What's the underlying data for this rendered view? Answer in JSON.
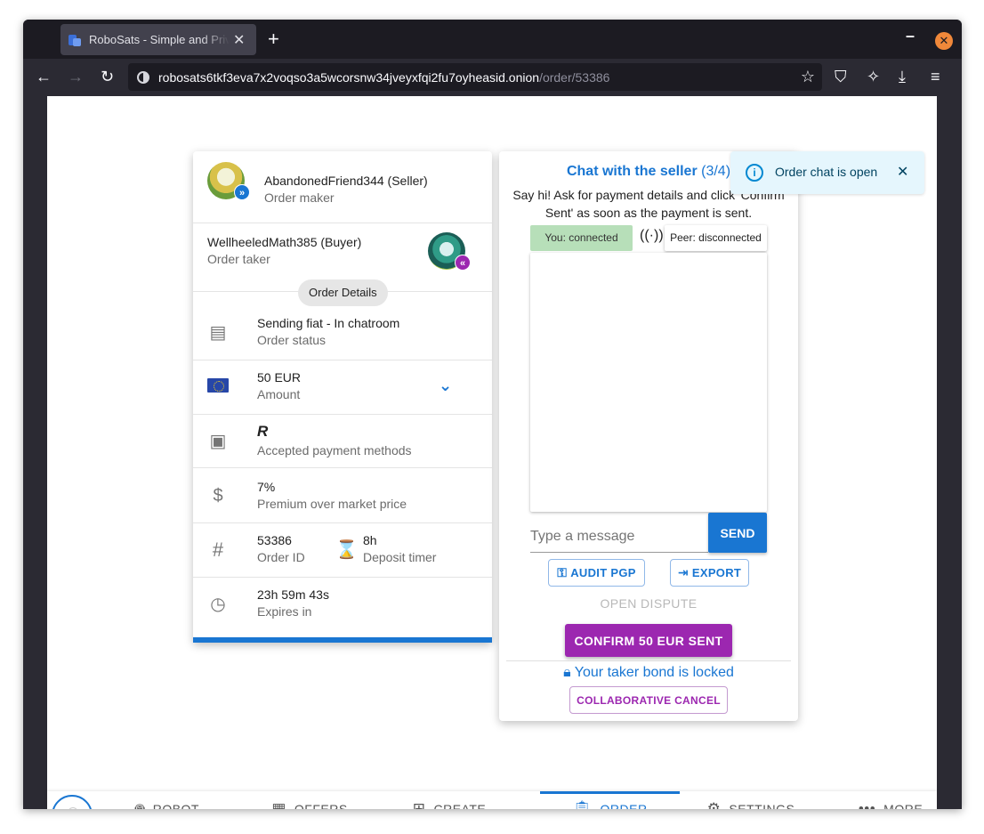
{
  "browser": {
    "tab_title": "RoboSats - Simple and Private Bitcoin Exchange",
    "url_host": "robosats6tkf3eva7x2voqso3a5wcorsnw34jveyxfqi2fu7oyheasid.onion",
    "url_path": "/order/53386"
  },
  "order": {
    "maker": {
      "name": "AbandonedFriend344 (Seller)",
      "role": "Order maker"
    },
    "taker": {
      "name": "WellheeledMath385 (Buyer)",
      "role": "Order taker"
    },
    "details_chip": "Order Details",
    "status": {
      "value": "Sending fiat - In chatroom",
      "label": "Order status"
    },
    "amount": {
      "value": "50 EUR",
      "label": "Amount"
    },
    "payment": {
      "value": "R",
      "label": "Accepted payment methods"
    },
    "premium": {
      "value": "7%",
      "label": "Premium over market price"
    },
    "order_id": {
      "value": "53386",
      "label": "Order ID"
    },
    "deposit": {
      "value": "8h",
      "label": "Deposit timer"
    },
    "expires": {
      "value": "23h 59m 43s",
      "label": "Expires in"
    },
    "progress_fraction": 1.0
  },
  "chat": {
    "title": "Chat with the seller",
    "count": "(3/4)",
    "hint": "Say hi! Ask for payment details and click 'Confirm Sent' as soon as the payment is sent.",
    "you_status": "You: connected",
    "peer_status": "Peer: disconnected",
    "input_placeholder": "Type a message",
    "send_label": "SEND",
    "audit_label": "AUDIT PGP",
    "export_label": "EXPORT",
    "dispute_label": "OPEN DISPUTE",
    "confirm_label": "CONFIRM 50 EUR SENT",
    "bond_text": "Your taker bond is locked",
    "collab_label": "COLLABORATIVE CANCEL"
  },
  "snackbar": {
    "text": "Order chat is open"
  },
  "bottom_nav": {
    "robot": "ROBOT",
    "offers": "OFFERS",
    "create": "CREATE",
    "order": "ORDER",
    "settings": "SETTINGS",
    "more": "MORE"
  },
  "colors": {
    "primary": "#1976d2",
    "secondary": "#9c27b0",
    "connected": "#b7dfb9"
  }
}
